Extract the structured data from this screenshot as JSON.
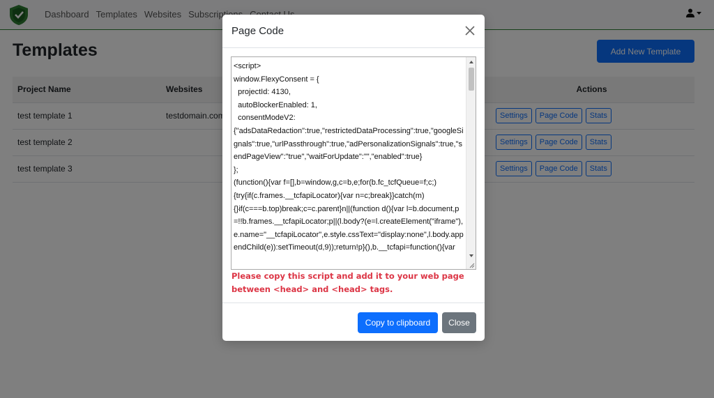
{
  "navbar": {
    "links": [
      "Dashboard",
      "Templates",
      "Websites",
      "Subscriptions",
      "Contact Us"
    ],
    "brand_color": "#2e7d32"
  },
  "page": {
    "title": "Templates",
    "add_button": "Add New Template"
  },
  "table": {
    "headers": [
      "Project Name",
      "Websites",
      "Actions"
    ],
    "rows": [
      {
        "name": "test template 1",
        "website": "testdomain.com"
      },
      {
        "name": "test template 2",
        "website": ""
      },
      {
        "name": "test template 3",
        "website": ""
      }
    ],
    "actions": [
      "Settings",
      "Page Code",
      "Stats"
    ]
  },
  "modal": {
    "title": "Page Code",
    "code": "<script>\nwindow.FlexyConsent = {\n  projectId: 4130,\n  autoBlockerEnabled: 1,\n  consentModeV2:\n{\"adsDataRedaction\":true,\"restrictedDataProcessing\":true,\"googleSignals\":true,\"urlPassthrough\":true,\"adPersonalizationSignals\":true,\"sendPageView\":\"true\",\"waitForUpdate\":\"\",\"enabled\":true}\n};\n(function(){var f=[],b=window,g,c=b,e;for(b.fc_tcfQueue=f;c;)\n{try{if(c.frames.__tcfapiLocator){var n=c;break}}catch(m)\n{}if(c===b.top)break;c=c.parent}n||(function d(){var l=b.document,p=!!b.frames.__tcfapiLocator;p||(l.body?(e=l.createElement(\"iframe\"),e.name=\"__tcfapiLocator\",e.style.cssText=\"display:none\",l.body.appendChild(e)):setTimeout(d,9));return!p}(),b.__tcfapi=function(){var",
    "warning": "Please copy this script and add it to your web page between <head> and <head> tags.",
    "copy_button": "Copy to clipboard",
    "close_button": "Close"
  },
  "colors": {
    "primary": "#0d6efd",
    "danger": "#dc3545",
    "secondary": "#6c757d"
  }
}
